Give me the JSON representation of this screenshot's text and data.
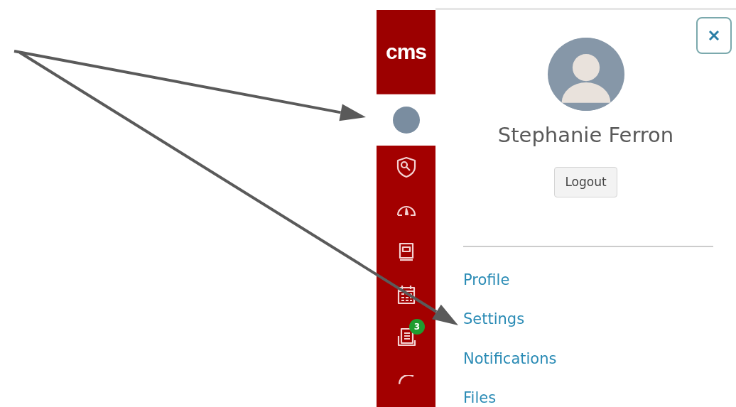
{
  "logo": {
    "text": "cms"
  },
  "global_nav": [
    {
      "kind": "avatar",
      "selected": true
    },
    {
      "kind": "icon",
      "selected": false
    },
    {
      "kind": "icon",
      "selected": false
    },
    {
      "kind": "icon",
      "selected": false
    },
    {
      "kind": "icon",
      "selected": false
    },
    {
      "kind": "icon",
      "selected": false,
      "badge": "3"
    },
    {
      "kind": "icon",
      "selected": false
    }
  ],
  "profile_tray": {
    "name": "Stephanie Ferron",
    "logout_button": "Logout",
    "links": [
      "Profile",
      "Settings",
      "Notifications",
      "Files"
    ]
  }
}
